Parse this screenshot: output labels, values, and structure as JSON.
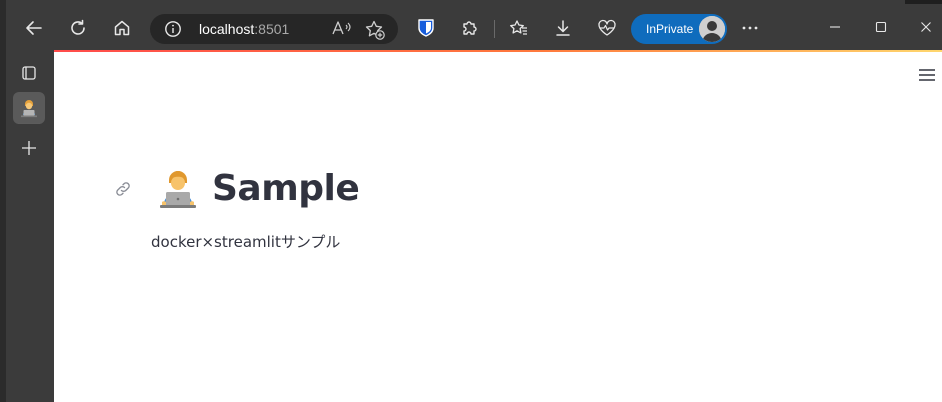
{
  "browser": {
    "url_host": "localhost",
    "url_port": ":8501",
    "inprivate_label": "InPrivate"
  },
  "icons": {
    "back": "back-arrow-icon",
    "refresh": "refresh-icon",
    "home": "home-icon",
    "site_info": "info-icon",
    "read_aloud": "read-aloud-icon",
    "add_favorite": "add-favorite-icon",
    "extension_bitwarden": "bitwarden-shield-icon",
    "extensions": "puzzle-piece-icon",
    "favorites": "favorites-star-icon",
    "downloads": "download-icon",
    "health": "heartbeat-icon",
    "more": "more-dots-icon",
    "minimize": "minimize-icon",
    "maximize": "maximize-icon",
    "close": "close-icon"
  },
  "page": {
    "title": "Sample",
    "title_emoji": "👨‍💻",
    "caption": "docker×streamlitサンプル"
  },
  "colors": {
    "toolbar_bg": "#3b3b3b",
    "inprivate_bg": "#0f6cbd",
    "title_color": "#31333f",
    "accent_start": "#ff4b4b",
    "accent_end": "#ffd76e"
  }
}
